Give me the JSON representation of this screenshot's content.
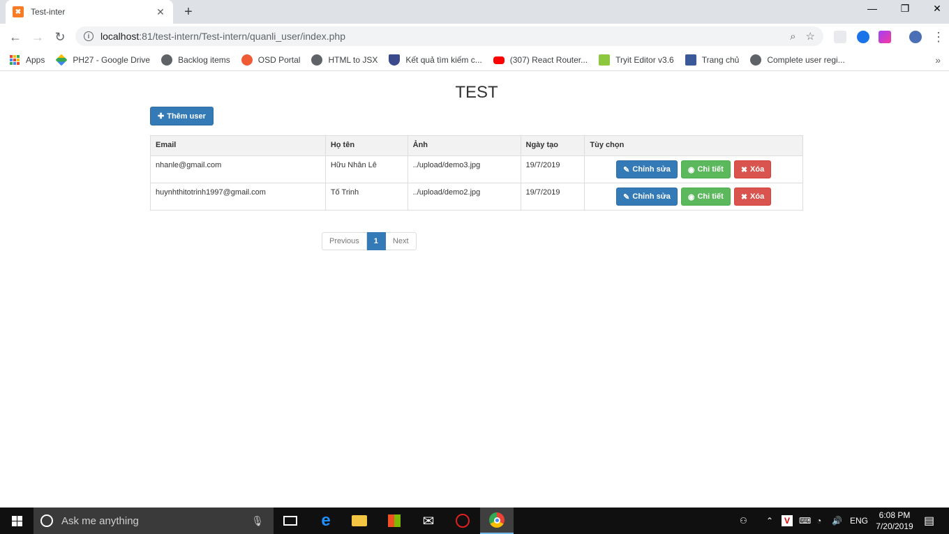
{
  "browser": {
    "tab_title": "Test-inter",
    "tab_close": "✕",
    "new_tab": "+",
    "url_host": "localhost",
    "url_rest": ":81/test-intern/Test-intern/quanli_user/index.php",
    "window_controls": [
      "—",
      "❐",
      "✕"
    ]
  },
  "bookmarks": [
    {
      "label": "Apps",
      "icon": "apps-grid-icon",
      "color": "#4285f4"
    },
    {
      "label": "PH27 - Google Drive",
      "icon": "google-drive-icon",
      "color": "#34a853"
    },
    {
      "label": "Backlog items",
      "icon": "globe-icon",
      "color": "#5f6368"
    },
    {
      "label": "OSD Portal",
      "icon": "circle-icon",
      "color": "#ef5b34"
    },
    {
      "label": "HTML to JSX",
      "icon": "globe-icon",
      "color": "#5f6368"
    },
    {
      "label": "Kết quả tìm kiếm c...",
      "icon": "shield-icon",
      "color": "#3b4a8c"
    },
    {
      "label": "(307) React Router...",
      "icon": "youtube-icon",
      "color": "#ff0000"
    },
    {
      "label": "Tryit Editor v3.6",
      "icon": "w3schools-icon",
      "color": "#8dc63f"
    },
    {
      "label": "Trang chủ",
      "icon": "facebook-icon",
      "color": "#3b5998"
    },
    {
      "label": "Complete user regi...",
      "icon": "globe-icon",
      "color": "#5f6368"
    }
  ],
  "page": {
    "title": "TEST",
    "add_button": "Thêm user",
    "columns": [
      "Email",
      "Họ tên",
      "Ảnh",
      "Ngày tạo",
      "Tùy chọn"
    ],
    "rows": [
      {
        "email": "nhanle@gmail.com",
        "name": "Hữu Nhân Lê",
        "image": "../upload/demo3.jpg",
        "created": "19/7/2019"
      },
      {
        "email": "huynhthitotrinh1997@gmail.com",
        "name": "Tố Trinh",
        "image": "../upload/demo2.jpg",
        "created": "19/7/2019"
      }
    ],
    "actions": {
      "edit": "Chỉnh sửa",
      "detail": "Chi tiết",
      "delete": "Xóa"
    },
    "pagination": {
      "previous": "Previous",
      "current": "1",
      "next": "Next"
    }
  },
  "taskbar": {
    "search_placeholder": "Ask me anything",
    "language": "ENG",
    "time": "6:08 PM",
    "date": "7/20/2019"
  },
  "colors": {
    "primary": "#337ab7",
    "success": "#5cb85c",
    "danger": "#d9534f"
  }
}
